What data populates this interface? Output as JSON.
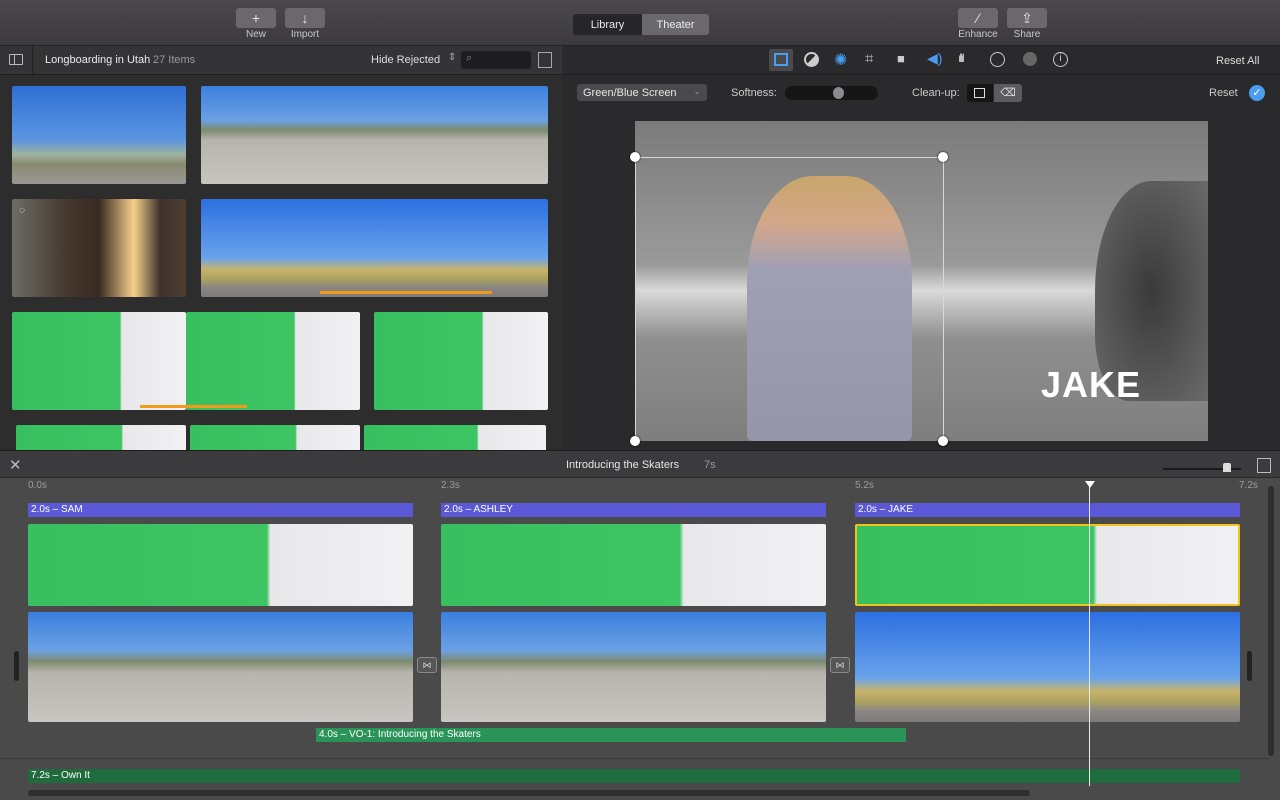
{
  "toolbar": {
    "new_label": "New",
    "import_label": "Import",
    "segments": [
      "Library",
      "Theater"
    ],
    "active_segment": "Library",
    "enhance_label": "Enhance",
    "share_label": "Share"
  },
  "library": {
    "title": "Longboarding in Utah",
    "item_count": "27 Items",
    "filter": "Hide Rejected",
    "search_placeholder": ""
  },
  "viewer": {
    "tools": [
      "overlay-settings",
      "color-balance",
      "color-correction",
      "cropping",
      "stabilization",
      "volume",
      "noise-reduction-equalizer",
      "speed",
      "clip-filter",
      "clip-info"
    ],
    "active_tool": "overlay-settings",
    "reset_all_label": "Reset All",
    "overlay_mode": "Green/Blue Screen",
    "softness_label": "Softness:",
    "softness_value": 0.6,
    "cleanup_label": "Clean-up:",
    "reset_label": "Reset",
    "preview_title_text": "JAKE"
  },
  "timeline": {
    "project_title": "Introducing the Skaters",
    "duration": "7s",
    "zoom_level": 0.83,
    "ruler": [
      "0.0s",
      "2.3s",
      "5.2s",
      "7.2s"
    ],
    "titles": [
      "2.0s – SAM",
      "2.0s – ASHLEY",
      "2.0s – JAKE"
    ],
    "voiceover": "4.0s – VO-1: Introducing the Skaters",
    "music": "7.2s – Own It"
  },
  "colors": {
    "title_track": "#5a58d6",
    "voiceover_track": "#2a9458",
    "music_track": "#1f6b3d",
    "selection": "#f0c419",
    "accent_blue": "#4a9df0"
  }
}
